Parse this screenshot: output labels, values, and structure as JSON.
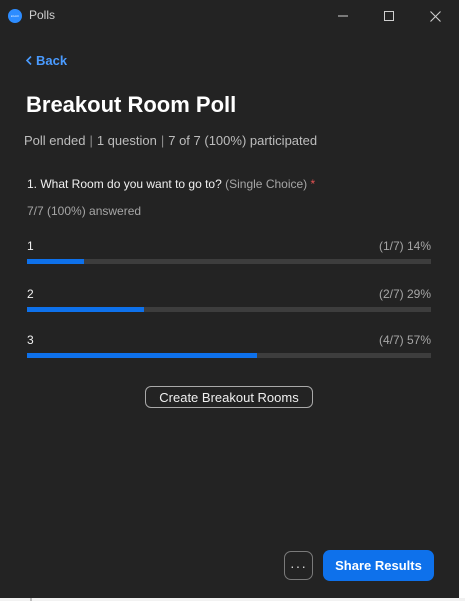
{
  "window": {
    "title": "Polls",
    "app_icon_text": "zoom",
    "accent": "#0e71eb"
  },
  "nav": {
    "back_label": "Back"
  },
  "poll": {
    "title": "Breakout Room Poll",
    "status": "Poll ended",
    "question_count": "1 question",
    "participation": "7 of 7 (100%) participated"
  },
  "question": {
    "text": "1. What Room do you want to go to?",
    "type": "(Single Choice)",
    "required_mark": "*",
    "answered": "7/7 (100%) answered",
    "options": [
      {
        "label": "1",
        "stat": "(1/7) 14%",
        "percent": 14
      },
      {
        "label": "2",
        "stat": "(2/7) 29%",
        "percent": 29
      },
      {
        "label": "3",
        "stat": "(4/7) 57%",
        "percent": 57
      }
    ]
  },
  "actions": {
    "create_breakout_label": "Create Breakout Rooms",
    "more_label": "···",
    "share_label": "Share Results"
  }
}
